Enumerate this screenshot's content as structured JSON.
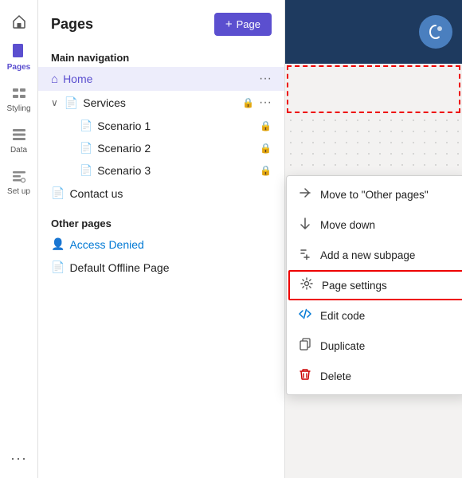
{
  "iconSidebar": {
    "items": [
      {
        "id": "home",
        "label": "",
        "icon": "home"
      },
      {
        "id": "pages",
        "label": "Pages",
        "icon": "pages",
        "active": true
      },
      {
        "id": "styling",
        "label": "Styling",
        "icon": "styling"
      },
      {
        "id": "data",
        "label": "Data",
        "icon": "data"
      },
      {
        "id": "setup",
        "label": "Set up",
        "icon": "setup"
      }
    ],
    "moreLabel": "..."
  },
  "pagesPanel": {
    "title": "Pages",
    "addPageLabel": "+ Page",
    "sections": [
      {
        "id": "main-navigation",
        "label": "Main navigation",
        "items": [
          {
            "id": "home",
            "label": "Home",
            "icon": "home",
            "active": true,
            "indent": 0
          },
          {
            "id": "services",
            "label": "Services",
            "icon": "page",
            "indent": 0,
            "expandable": true,
            "lock": true
          },
          {
            "id": "scenario1",
            "label": "Scenario 1",
            "icon": "page",
            "indent": 1,
            "lock": true
          },
          {
            "id": "scenario2",
            "label": "Scenario 2",
            "icon": "page",
            "indent": 1,
            "lock": true
          },
          {
            "id": "scenario3",
            "label": "Scenario 3",
            "icon": "page",
            "indent": 1,
            "lock": true
          },
          {
            "id": "contact",
            "label": "Contact us",
            "icon": "page-orange",
            "indent": 0
          }
        ]
      },
      {
        "id": "other-pages",
        "label": "Other pages",
        "items": [
          {
            "id": "access-denied",
            "label": "Access Denied",
            "icon": "person",
            "indent": 0,
            "color": "blue"
          },
          {
            "id": "offline",
            "label": "Default Offline Page",
            "icon": "page-orange",
            "indent": 0
          }
        ]
      }
    ]
  },
  "contextMenu": {
    "items": [
      {
        "id": "move-to-other",
        "label": "Move to \"Other pages\"",
        "icon": "move-icon",
        "iconType": "move"
      },
      {
        "id": "move-down",
        "label": "Move down",
        "icon": "arrow-down",
        "iconType": "down"
      },
      {
        "id": "add-subpage",
        "label": "Add a new subpage",
        "icon": "subpage-icon",
        "iconType": "subpage"
      },
      {
        "id": "page-settings",
        "label": "Page settings",
        "icon": "gear-icon",
        "iconType": "gear",
        "highlighted": true
      },
      {
        "id": "edit-code",
        "label": "Edit code",
        "icon": "code-icon",
        "iconType": "code"
      },
      {
        "id": "duplicate",
        "label": "Duplicate",
        "icon": "duplicate-icon",
        "iconType": "duplicate"
      },
      {
        "id": "delete",
        "label": "Delete",
        "icon": "delete-icon",
        "iconType": "delete"
      }
    ]
  }
}
